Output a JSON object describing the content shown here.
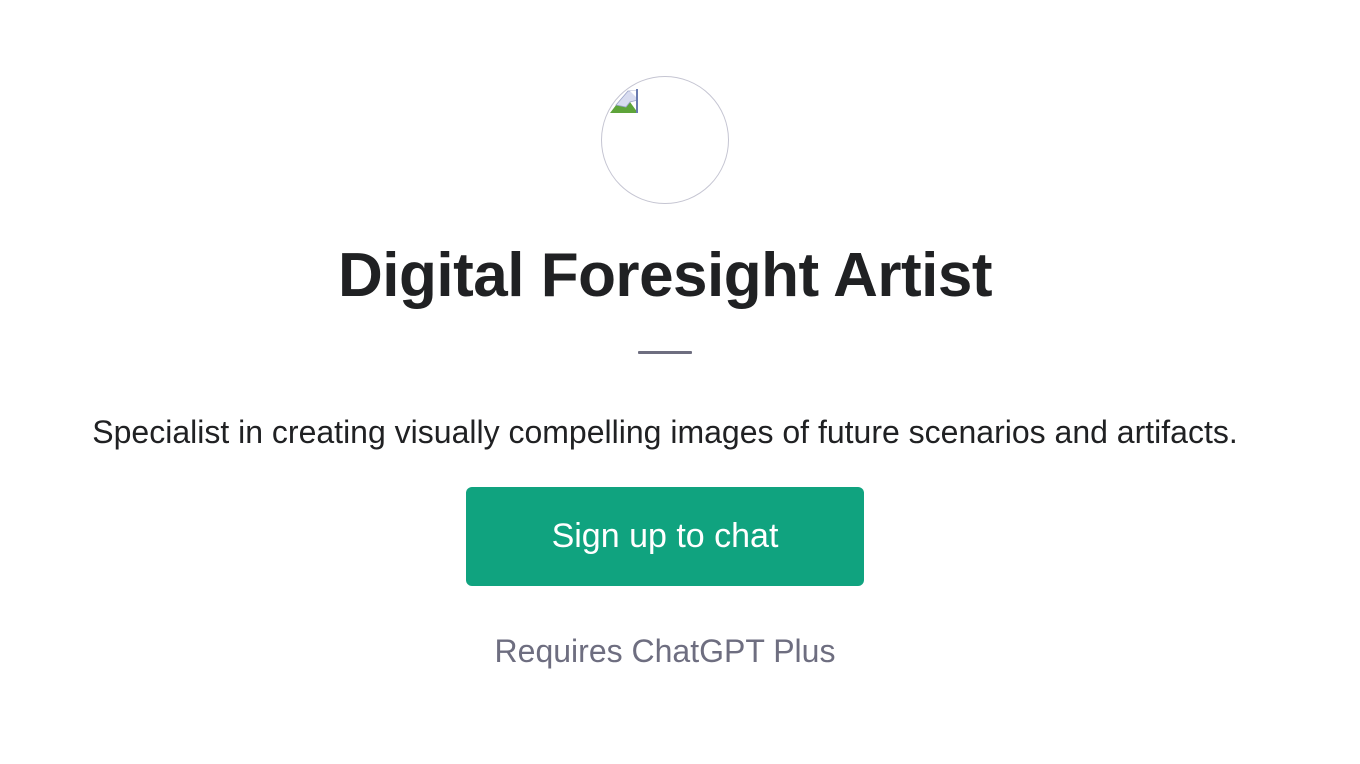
{
  "gpt": {
    "avatar_icon": "broken-image-icon",
    "name": "Digital Foresight Artist",
    "description": "Specialist in creating visually compelling images of future scenarios and artifacts.",
    "signup_label": "Sign up to chat",
    "requirement_note": "Requires ChatGPT Plus"
  },
  "colors": {
    "accent": "#10a37f",
    "text_primary": "#202123",
    "text_secondary": "#6e6e80",
    "divider": "#6e6e80"
  }
}
